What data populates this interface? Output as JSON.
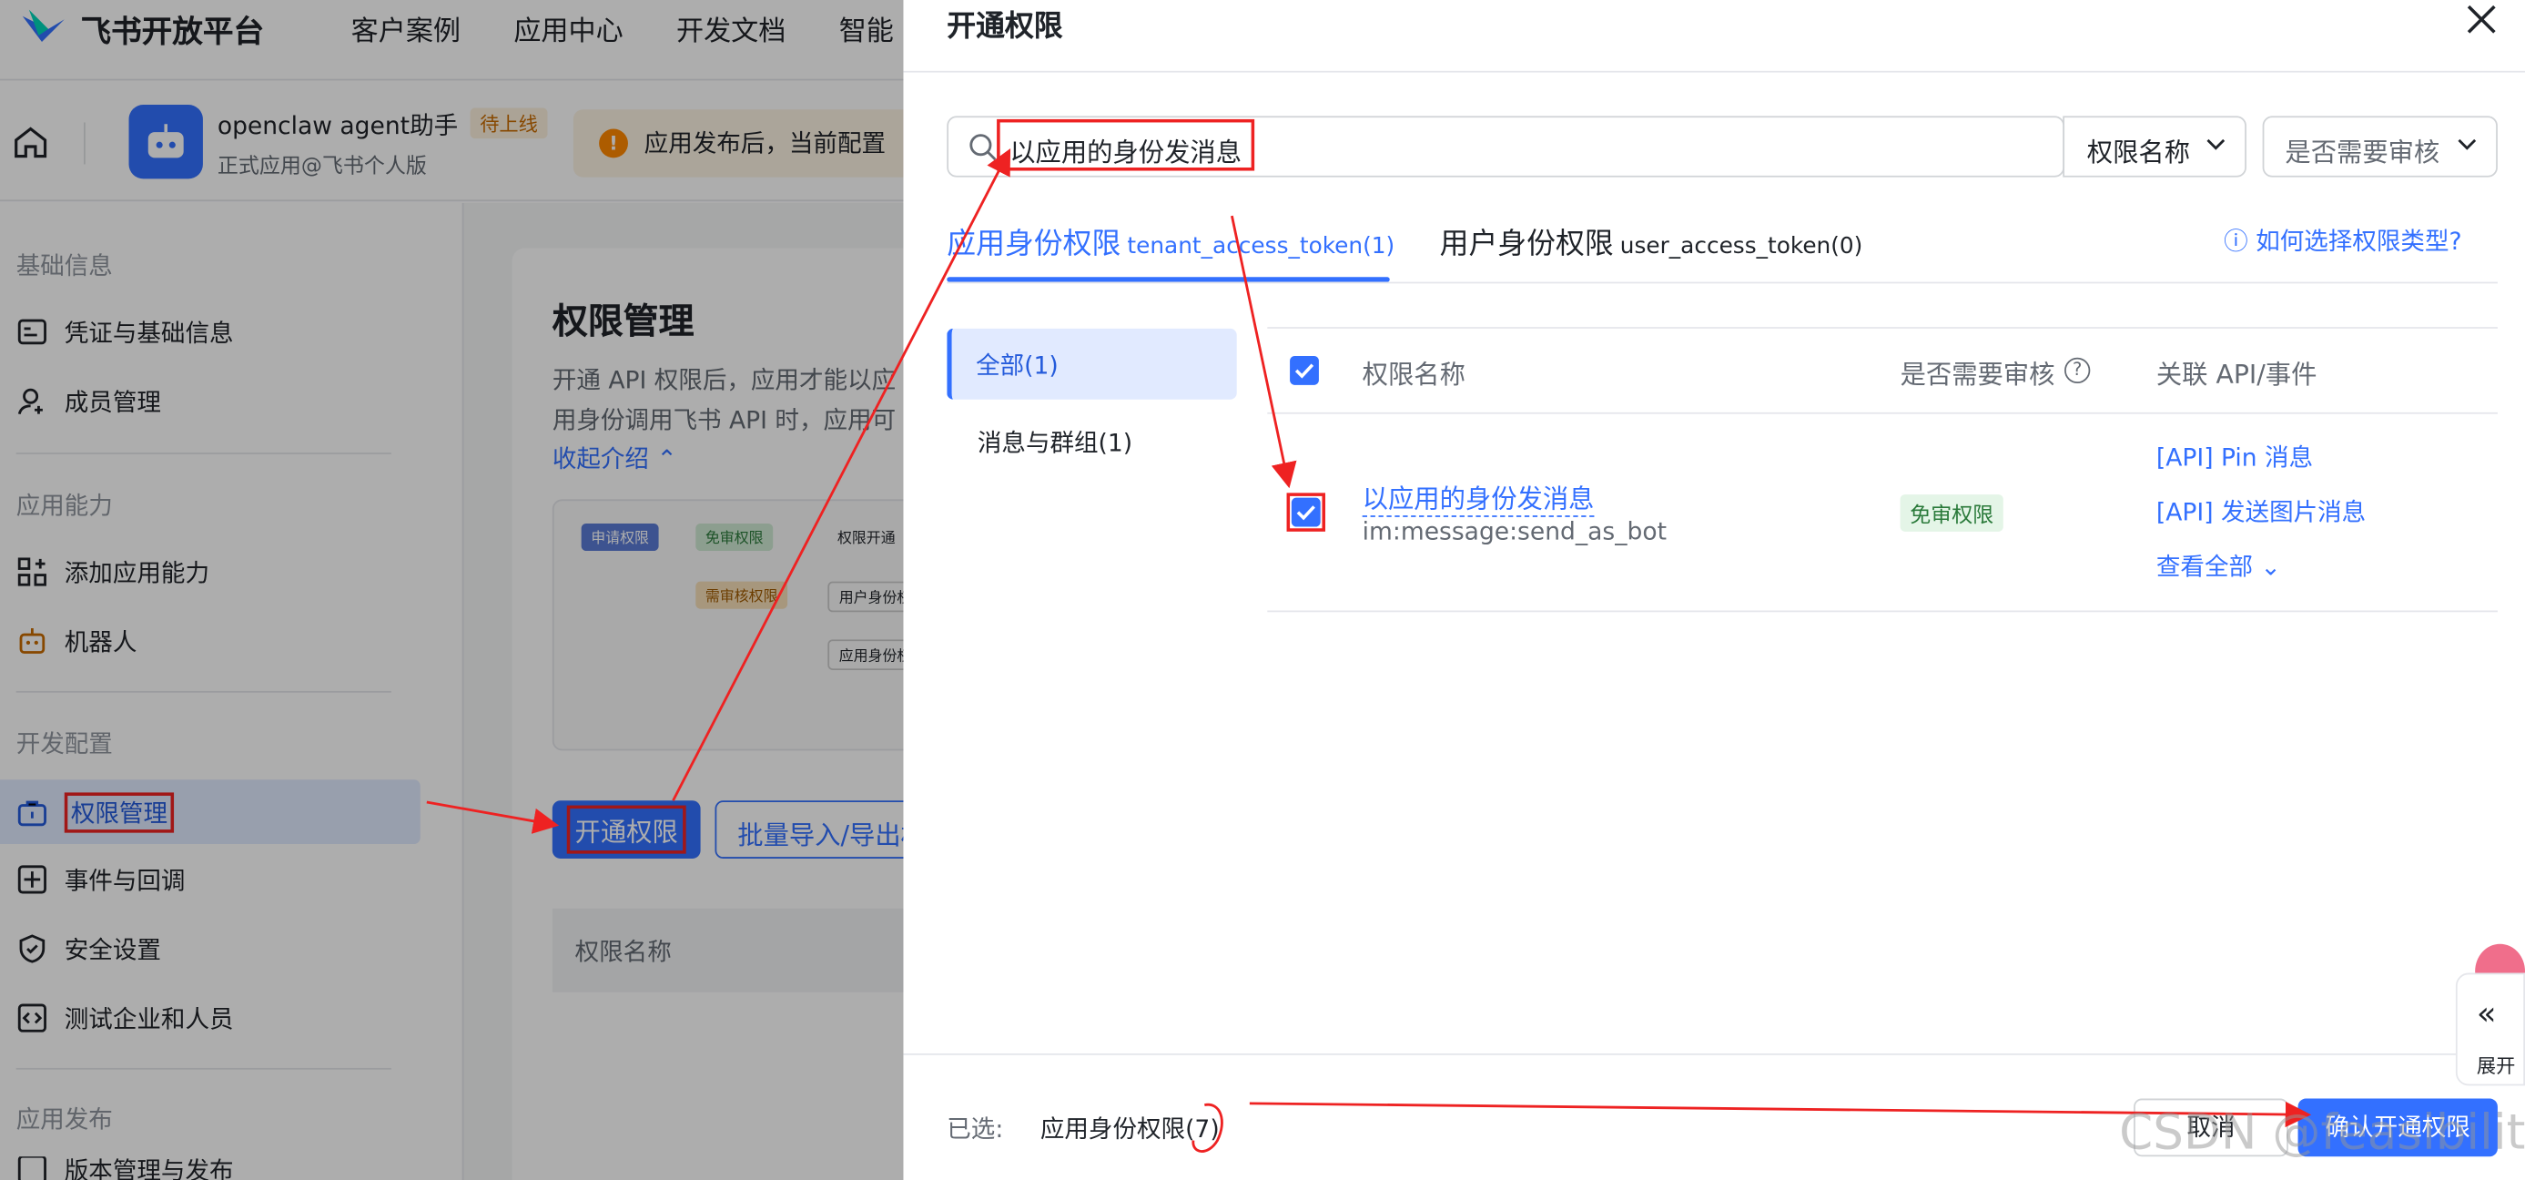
{
  "topbar": {
    "brand": "飞书开放平台",
    "nav": [
      "客户案例",
      "应用中心",
      "开发文档",
      "智能"
    ]
  },
  "app": {
    "name": "openclaw agent助手",
    "status": "待上线",
    "subtitle": "正式应用@飞书个人版",
    "notice": "应用发布后，当前配置"
  },
  "sidebar": {
    "groups": [
      "基础信息",
      "应用能力",
      "开发配置",
      "应用发布"
    ],
    "items": [
      {
        "label": "凭证与基础信息",
        "icon": "credential-icon"
      },
      {
        "label": "成员管理",
        "icon": "member-icon"
      },
      {
        "label": "添加应用能力",
        "icon": "grid-add-icon"
      },
      {
        "label": "机器人",
        "icon": "robot-icon"
      },
      {
        "label": "权限管理",
        "icon": "lock-icon"
      },
      {
        "label": "事件与回调",
        "icon": "event-icon"
      },
      {
        "label": "安全设置",
        "icon": "shield-icon"
      },
      {
        "label": "测试企业和人员",
        "icon": "code-icon"
      },
      {
        "label": "版本管理与发布",
        "icon": "version-icon"
      }
    ]
  },
  "page": {
    "title": "权限管理",
    "description": "开通 API 权限后，应用才能以应用身份调用飞书 API 时，应用可能还需",
    "collapse_label": "收起介绍",
    "diagram": [
      "申请权限",
      "免审权限",
      "权限开通",
      "需审核权限",
      "用户身份权限",
      "应用身份权限"
    ],
    "open_button": "开通权限",
    "batch_button": "批量导入/导出权限",
    "table_header": "权限名称"
  },
  "drawer": {
    "title": "开通权限",
    "search_value": "以应用的身份发消息",
    "filter_name": "权限名称",
    "filter_review": "是否需要审核",
    "tabs": [
      {
        "label": "应用身份权限",
        "token": "tenant_access_token(1)"
      },
      {
        "label": "用户身份权限",
        "token": "user_access_token(0)"
      }
    ],
    "help_link": "如何选择权限类型?",
    "categories": [
      "全部(1)",
      "消息与群组(1)"
    ],
    "columns": [
      "权限名称",
      "是否需要审核",
      "关联 API/事件"
    ],
    "row": {
      "name": "以应用的身份发消息",
      "code": "im:message:send_as_bot",
      "review": "免审权限",
      "apis": [
        "[API] Pin 消息",
        "[API] 发送图片消息"
      ],
      "view_all": "查看全部"
    },
    "footer": {
      "selected_label": "已选:",
      "selected_value": "应用身份权限(7)",
      "cancel": "取消",
      "confirm": "确认开通权限"
    },
    "expand_label": "展开"
  },
  "watermark": "CSDN @feasibility.",
  "colors": {
    "primary": "#3370ff",
    "annotation": "#e22222",
    "active_bg": "#e1eaff"
  }
}
